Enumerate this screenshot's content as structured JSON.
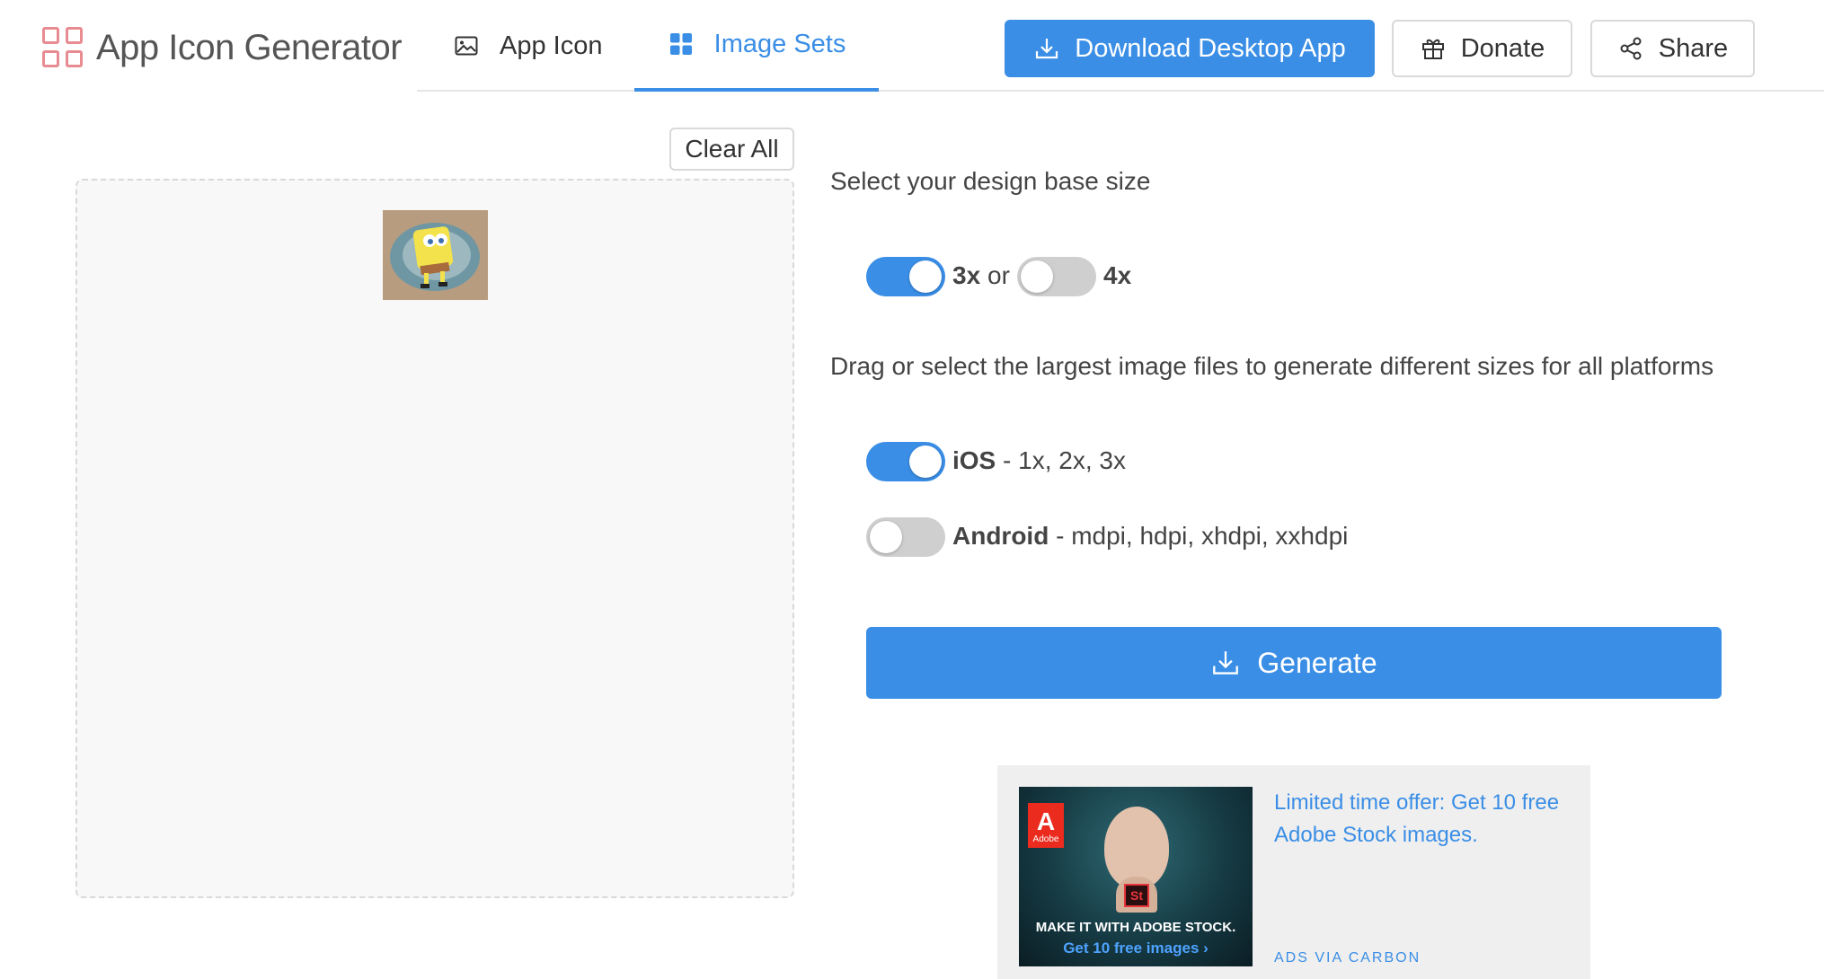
{
  "header": {
    "brand": "App Icon Generator",
    "tabs": [
      {
        "label": "App Icon",
        "icon": "image-icon",
        "active": false
      },
      {
        "label": "Image Sets",
        "icon": "grid-icon",
        "active": true
      }
    ],
    "download_button": "Download Desktop App",
    "donate_button": "Donate",
    "share_button": "Share"
  },
  "left": {
    "clear_all": "Clear All"
  },
  "right": {
    "base_size_label": "Select your design base size",
    "options": {
      "x3": {
        "label": "3x",
        "on": true
      },
      "or": "or",
      "x4": {
        "label": "4x",
        "on": false
      }
    },
    "drag_label": "Drag or select the largest image files to generate different sizes for all platforms",
    "platforms": [
      {
        "name": "iOS",
        "sizes": " - 1x, 2x, 3x",
        "on": true
      },
      {
        "name": "Android",
        "sizes": " - mdpi, hdpi, xhdpi, xxhdpi",
        "on": false
      }
    ],
    "generate_button": "Generate"
  },
  "ad": {
    "brand": "Adobe",
    "badge": "St",
    "caption_line1": "MAKE IT WITH ADOBE STOCK.",
    "caption_line2": "Get 10 free images ›",
    "text": "Limited time offer: Get 10 free Adobe Stock images.",
    "via": "ADS VIA CARBON"
  },
  "colors": {
    "accent": "#3a8ee6",
    "toggle_off": "#cfcfcf",
    "logo": "#e88b93"
  }
}
